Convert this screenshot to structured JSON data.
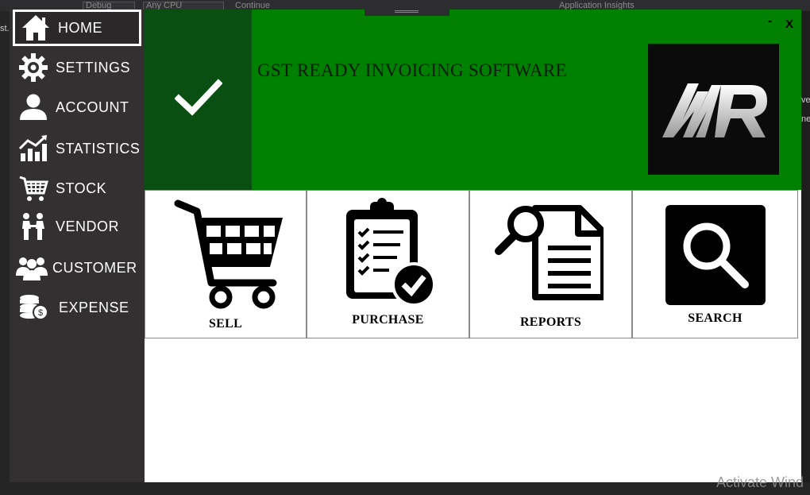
{
  "ide": {
    "combo_left": "Debug",
    "combo_right": "Any CPU",
    "continue_label": "Continue",
    "insights_label": "Application Insights",
    "left_edge_text": "st.",
    "right_edge_text_1": "ve",
    "right_edge_text_2": "ne",
    "watermark": "Activate Wind"
  },
  "sidebar": {
    "items": [
      {
        "label": "HOME",
        "icon": "home-icon",
        "active": true
      },
      {
        "label": "SETTINGS",
        "icon": "gear-icon",
        "active": false
      },
      {
        "label": "ACCOUNT",
        "icon": "user-icon",
        "active": false
      },
      {
        "label": "STATISTICS",
        "icon": "chart-icon",
        "active": false
      },
      {
        "label": "STOCK",
        "icon": "cart-icon",
        "active": false
      },
      {
        "label": "VENDOR",
        "icon": "handshake-icon",
        "active": false
      },
      {
        "label": "CUSTOMER",
        "icon": "group-icon",
        "active": false
      },
      {
        "label": "EXPENSE",
        "icon": "coins-icon",
        "active": false
      }
    ]
  },
  "banner": {
    "title": "GST READY INVOICING SOFTWARE",
    "minimize_label": "-",
    "close_label": "X",
    "logo_text": "MR",
    "background": "#008000",
    "check_panel_color": "#0a4f12"
  },
  "tiles": [
    {
      "label": "SELL",
      "icon": "shopping-cart-icon"
    },
    {
      "label": "PURCHASE",
      "icon": "clipboard-check-icon"
    },
    {
      "label": "REPORTS",
      "icon": "document-search-icon"
    },
    {
      "label": "SEARCH",
      "icon": "magnifier-icon"
    }
  ]
}
